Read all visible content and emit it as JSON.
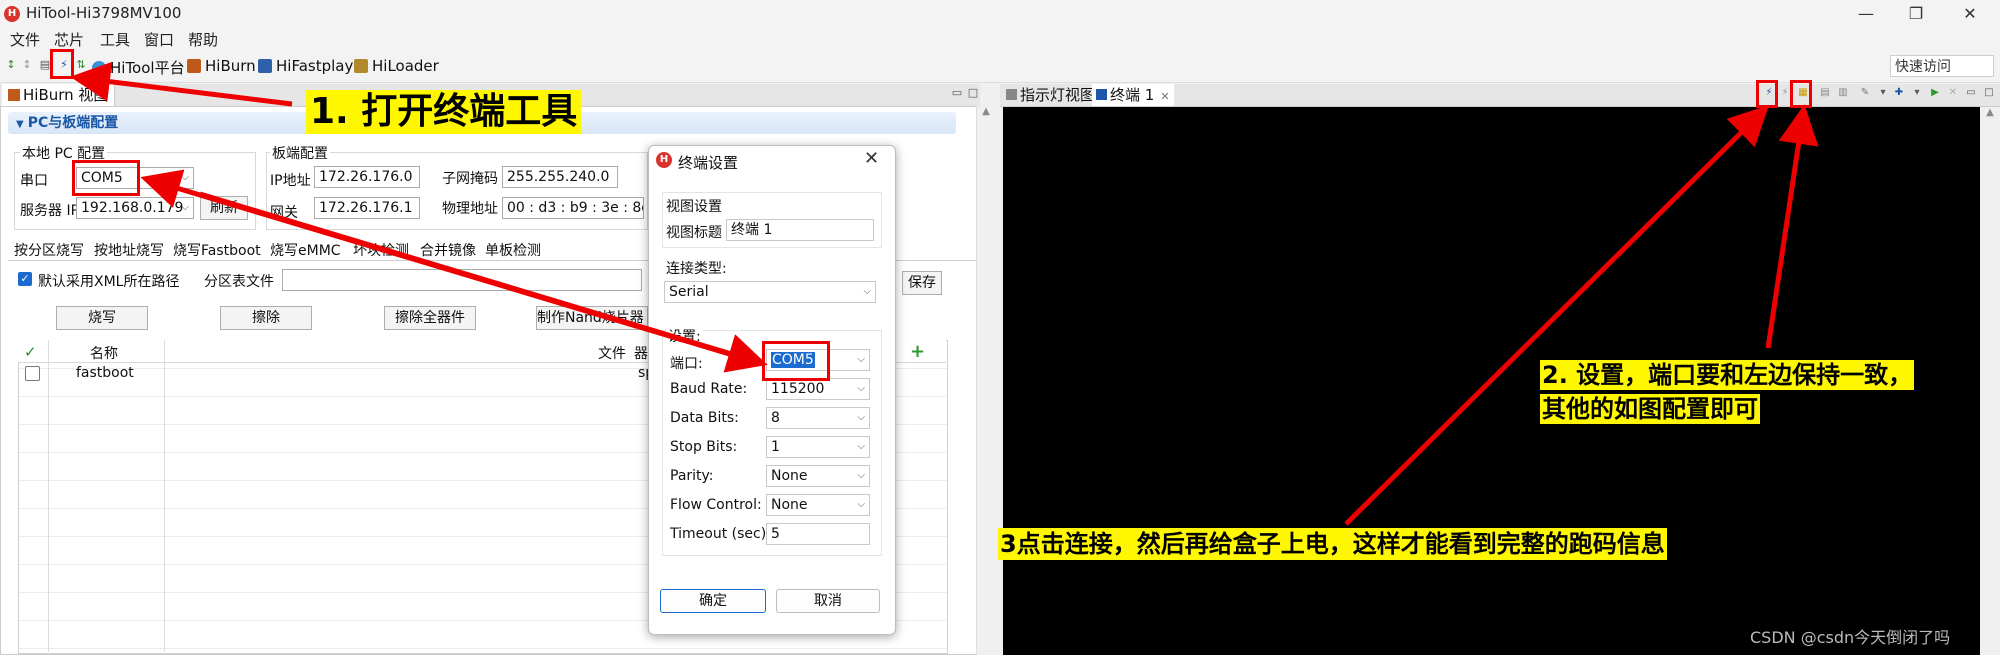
{
  "window": {
    "title": "HiTool-Hi3798MV100",
    "min": "—",
    "max": "❐",
    "close": "✕"
  },
  "menu": [
    "文件",
    "芯片",
    "工具",
    "窗口",
    "帮助"
  ],
  "toolbar": {
    "items": [
      "HiTool平台",
      "HiBurn",
      "HiFastplay",
      "HiLoader"
    ],
    "quick_access": "快速访问"
  },
  "left_view": {
    "tab": "HiBurn 视图",
    "section": "PC与板端配置",
    "local_group": "本地 PC 配置",
    "serial_label": "串口",
    "serial_value": "COM5",
    "server_label": "服务器 IP",
    "server_value": "192.168.0.179",
    "refresh": "刷新",
    "board_group": "板端配置",
    "ip_label": "IP地址",
    "ip_value": "172.26.176.0",
    "mask_label": "子网掩码",
    "mask_value": "255.255.240.0",
    "gw_label": "网关",
    "gw_value": "172.26.176.1",
    "mac_label": "物理地址",
    "mac_value": "00 : d3 : b9 : 3e : 8e",
    "tabs": [
      "按分区烧写",
      "按地址烧写",
      "烧写Fastboot",
      "烧写eMMC",
      "坏块检测",
      "合并镜像",
      "单板检测"
    ],
    "xml_checkbox": "默认采用XML所在路径",
    "partition_label": "分区表文件",
    "save": "保存",
    "buttons": [
      "烧写",
      "擦除",
      "擦除全器件",
      "制作Nand烧片器镜"
    ],
    "table_headers": [
      "名称",
      "文件",
      "器"
    ],
    "table_rows": [
      {
        "name": "fastboot",
        "extra": "sp"
      }
    ]
  },
  "right_view": {
    "tabs": [
      "指示灯视图",
      "终端 1"
    ]
  },
  "dialog": {
    "title": "终端设置",
    "view_settings": "视图设置",
    "view_title_label": "视图标题",
    "view_title_value": "终端 1",
    "conn_type_label": "连接类型:",
    "conn_type_value": "Serial",
    "settings_label": "设置:",
    "fields": [
      {
        "label": "端口:",
        "value": "COM5"
      },
      {
        "label": "Baud Rate:",
        "value": "115200"
      },
      {
        "label": "Data Bits:",
        "value": "8"
      },
      {
        "label": "Stop Bits:",
        "value": "1"
      },
      {
        "label": "Parity:",
        "value": "None"
      },
      {
        "label": "Flow Control:",
        "value": "None"
      },
      {
        "label": "Timeout (sec):",
        "value": "5"
      }
    ],
    "ok": "确定",
    "cancel": "取消"
  },
  "annotations": {
    "note1": "1. 打开终端工具",
    "note2_line1": "2. 设置，端口要和左边保持一致，",
    "note2_line2": "其他的如图配置即可",
    "note3": "3点击连接，然后再给盒子上电，这样才能看到完整的跑码信息",
    "watermark": "CSDN @csdn今天倒闭了吗"
  },
  "colors": {
    "annotation_red": "#ee0000",
    "highlight_yellow": "#fff700",
    "terminal_bg": "#000000"
  }
}
